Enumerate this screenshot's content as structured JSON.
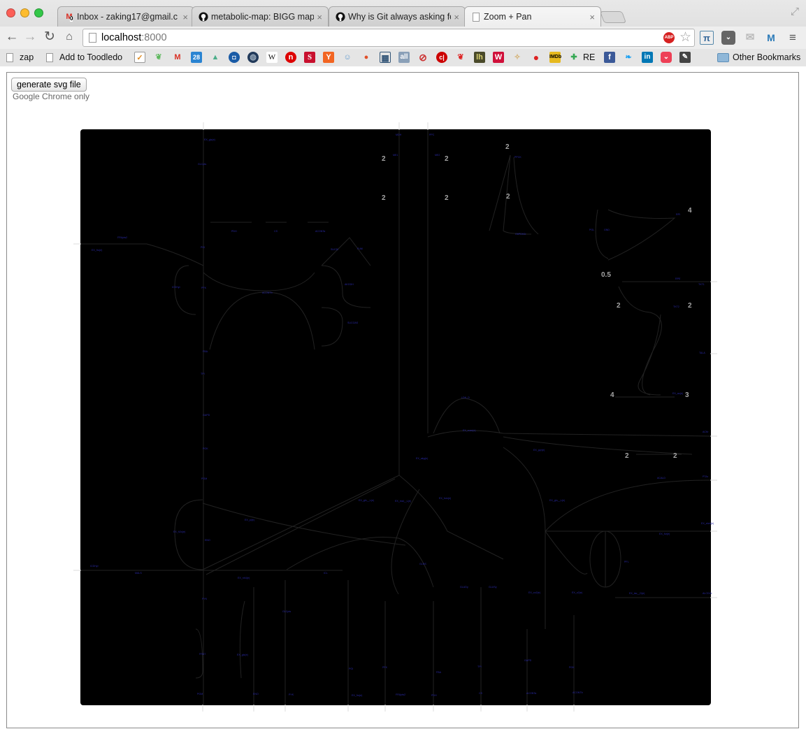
{
  "browser": {
    "tabs": [
      {
        "title": "Inbox - zaking17@gmail.c",
        "icon": "gmail-icon",
        "badge": "0"
      },
      {
        "title": "metabolic-map: BIGG map",
        "icon": "github-icon"
      },
      {
        "title": "Why is Git always asking fo",
        "icon": "github-icon"
      },
      {
        "title": "Zoom + Pan",
        "icon": "page-icon",
        "active": true
      }
    ],
    "url_host": "localhost",
    "url_port": ":8000",
    "bookmarks": {
      "text_items": [
        "zap",
        "Add to Toodledo"
      ],
      "icons": [
        "toodledo-check-icon",
        "leaf-icon",
        "gmail-icon",
        "calendar-icon",
        "mountain-icon",
        "chase-icon",
        "globe-icon",
        "wikipedia-icon",
        "n-icon",
        "s-icon",
        "ycombinator-icon",
        "reddit-icon",
        "drop-icon",
        "grid-icon",
        "all-icon",
        "stripe-circle-icon",
        "c-icon",
        "apple-icon",
        "lh-icon",
        "w-icon",
        "sun-icon",
        "tomato-icon",
        "imdb-icon",
        "google-plus-icon"
      ],
      "re_label": "RE",
      "social_icons": [
        "facebook-icon",
        "twitter-icon",
        "linkedin-icon",
        "pocket-icon",
        "pencil-icon"
      ],
      "other_label": "Other Bookmarks",
      "calendar_num": "28",
      "wiki_letter": "W",
      "all_text": "all",
      "imdb_text": "IMDb",
      "lh_text": "lh"
    },
    "extensions": {
      "abp": "ABP"
    }
  },
  "page": {
    "button_label": "generate svg file",
    "note": "Google Chrome only"
  },
  "map": {
    "background": "#000000",
    "label_color": "#2a2aa8",
    "node_label_color": "#a5a5a5",
    "node_labels": [
      {
        "text": "2"
      },
      {
        "text": "2"
      },
      {
        "text": "2"
      },
      {
        "text": "2"
      },
      {
        "text": "2"
      },
      {
        "text": "2"
      },
      {
        "text": "4"
      },
      {
        "text": "0.5"
      },
      {
        "text": "2"
      },
      {
        "text": "2"
      },
      {
        "text": "4"
      },
      {
        "text": "3"
      },
      {
        "text": "2"
      },
      {
        "text": "2"
      }
    ],
    "reaction_labels": [
      "EX_glc(e)",
      "GLCpts",
      "PGI",
      "PFK",
      "FBA",
      "TPI",
      "GAPD",
      "PGK",
      "PGM",
      "ENO",
      "PYK",
      "EX_fru(e)",
      "FRUpts2",
      "PDH",
      "CS",
      "ACONTa",
      "ACONTb",
      "ICDHyr",
      "AKGDH",
      "SUCOAS",
      "SUCDi",
      "FUM",
      "MDH",
      "ME1",
      "ME2",
      "PPC",
      "PPCK",
      "G6PDH2r",
      "PGL",
      "GND",
      "RPI",
      "RPE",
      "TKT1",
      "TKT2",
      "TALA",
      "EX_ac(e)",
      "ACKr",
      "PTAr",
      "EX_etoh(e)",
      "ALCD2x",
      "ACALD",
      "EX_for(e)",
      "PFL",
      "EX_lac__D(e)",
      "LDH_D",
      "EX_succ(e)",
      "EX_akg(e)",
      "EX_pyr(e)",
      "EX_mal__L(e)",
      "EX_fum(e)",
      "EX_gln__L(e)",
      "EX_glu__L(e)",
      "GLNS",
      "GLUDy",
      "GLUSy",
      "EX_co2(e)",
      "EX_o2(e)",
      "EX_h2o(e)",
      "EX_pi(e)",
      "EX_nh4(e)",
      "ICL",
      "MALS",
      "FRD7"
    ]
  }
}
